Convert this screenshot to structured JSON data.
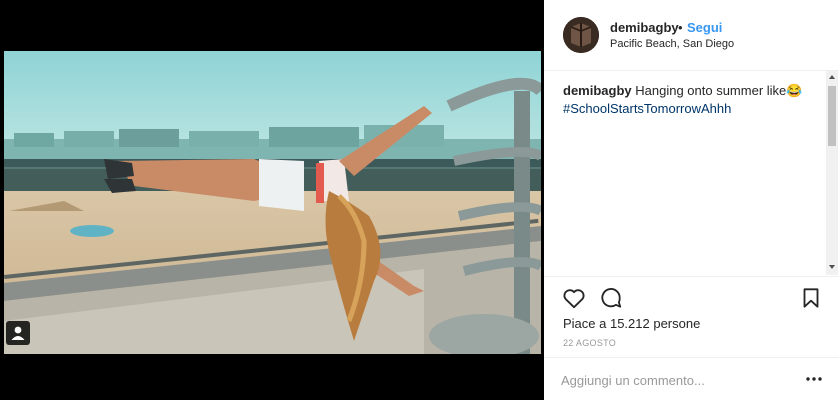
{
  "post": {
    "username": "demibagby",
    "separator": "•",
    "follow_label": "Segui",
    "location": "Pacific Beach, San Diego",
    "caption": {
      "username": "demibagby",
      "text": "Hanging onto summer like😂",
      "hashtag": "#SchoolStartsTomorrowAhhh"
    },
    "likes_text": "Piace a 15.212 persone",
    "date": "22 AGOSTO",
    "comment_placeholder": "Aggiungi un commento...",
    "icons": {
      "like": "heart-icon",
      "comment": "comment-bubble-icon",
      "save": "bookmark-icon",
      "more": "more-options-icon",
      "tag": "user-tag-icon"
    }
  },
  "colors": {
    "follow": "#3897f0",
    "hashtag": "#003569",
    "text": "#262626",
    "muted": "#999999",
    "border": "#efefef"
  }
}
